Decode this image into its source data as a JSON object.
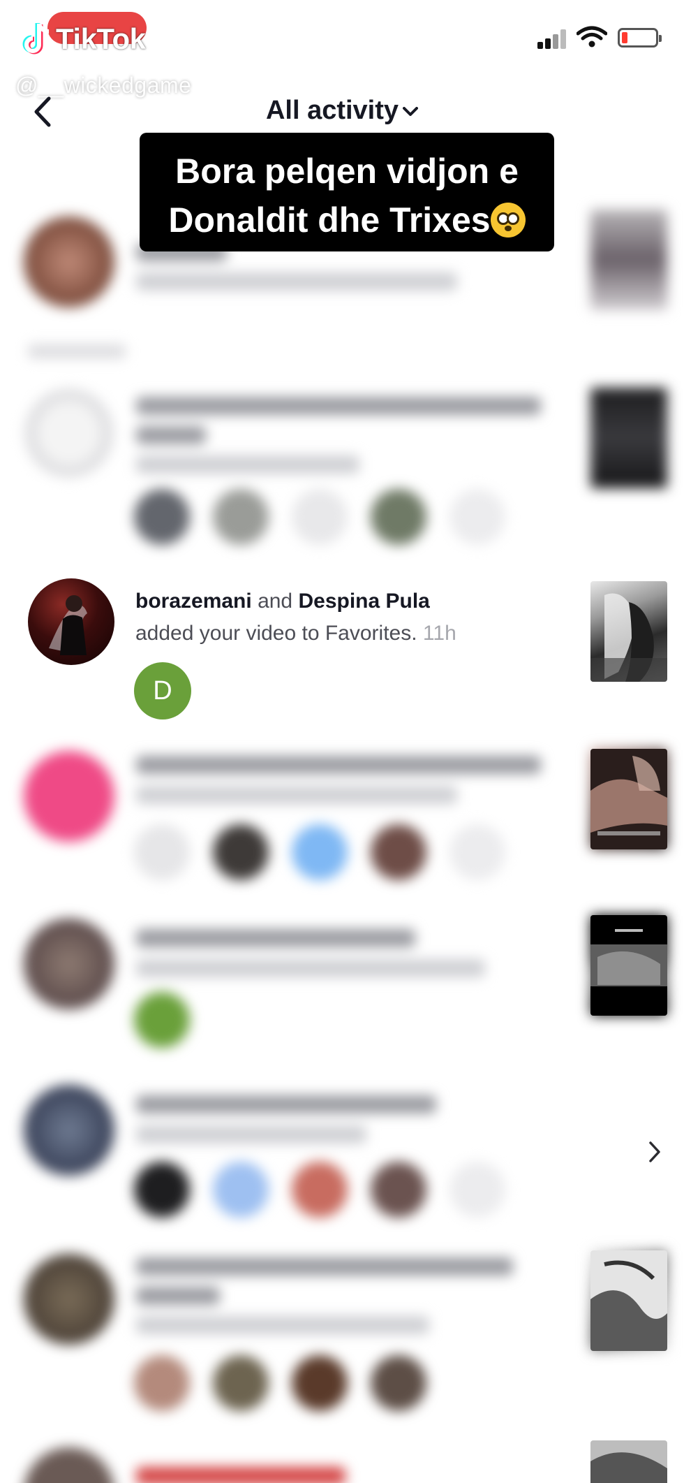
{
  "watermark": {
    "app_name": "TikTok",
    "handle": "@__wickedgame"
  },
  "header": {
    "title": "All activity"
  },
  "caption": {
    "line1": "Bora pelqen vidjon e",
    "line2": "Donaldit dhe Trixes"
  },
  "focused_item": {
    "user1": "borazemani",
    "connector": "and",
    "user2": "Despina Pula",
    "action": "added your video to Favorites.",
    "time": "11h",
    "badge_letter": "D",
    "badge_color": "#6aa03a"
  },
  "colors": {
    "accent": "#fe2c55",
    "text": "#161823",
    "muted": "#a6a7ad"
  }
}
